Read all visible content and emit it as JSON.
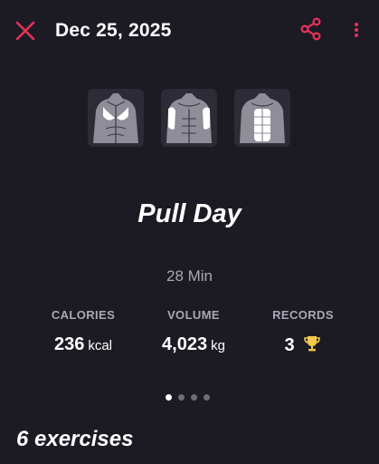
{
  "header": {
    "title": "Dec 25, 2025",
    "close_icon": "close-icon",
    "share_icon": "share-icon",
    "more_icon": "more-vertical-icon",
    "accent_color": "#e8325a"
  },
  "muscle_groups": [
    {
      "name": "back",
      "icon": "back-muscle-icon"
    },
    {
      "name": "arms",
      "icon": "arms-muscle-icon"
    },
    {
      "name": "core",
      "icon": "core-muscle-icon"
    }
  ],
  "workout": {
    "name": "Pull Day",
    "duration": "28 Min"
  },
  "stats": {
    "calories": {
      "label": "CALORIES",
      "value": "236",
      "unit": "kcal"
    },
    "volume": {
      "label": "VOLUME",
      "value": "4,023",
      "unit": "kg"
    },
    "records": {
      "label": "RECORDS",
      "value": "3",
      "icon": "trophy-icon"
    }
  },
  "pager": {
    "count": 4,
    "active_index": 0
  },
  "exercises": {
    "heading": "6 exercises"
  },
  "colors": {
    "background": "#1c1b24",
    "tile": "#2c2b36",
    "muted_text": "#a9a8b3",
    "trophy": "#f2c94c"
  }
}
